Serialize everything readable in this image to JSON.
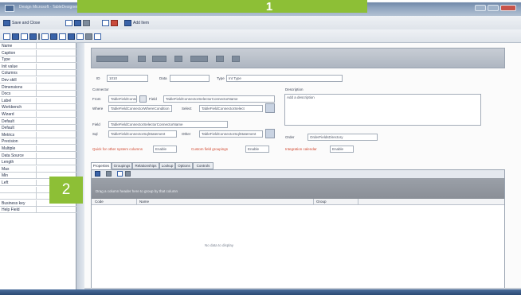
{
  "window": {
    "title": "Design Microsoft · TableDesigner · Microsoft Dynamics",
    "controls": [
      "minimize",
      "maximize",
      "close"
    ]
  },
  "callouts": [
    "1",
    "2"
  ],
  "toolbar1": {
    "items": [
      {
        "label": "Save and Close",
        "icon": "save-icon"
      },
      {
        "label": "",
        "icon": "new-icon"
      },
      {
        "label": "",
        "icon": "delete-icon"
      },
      {
        "label": "Add Item",
        "icon": "add-icon"
      }
    ]
  },
  "toolbar2": {
    "icons": [
      "text-icon",
      "field-icon",
      "grid-icon",
      "list-icon",
      "table-icon",
      "link-icon",
      "image-icon",
      "chart-icon",
      "help-icon"
    ]
  },
  "left_pane": {
    "rows": [
      {
        "label": "Name",
        "value": ""
      },
      {
        "label": "Caption",
        "value": ""
      },
      {
        "label": "Type",
        "value": ""
      },
      {
        "label": "Init value",
        "value": ""
      },
      {
        "label": "Columns",
        "value": ""
      },
      {
        "label": "Dev skill",
        "value": ""
      },
      {
        "label": "Dimensions",
        "value": ""
      },
      {
        "label": "Docs",
        "value": ""
      },
      {
        "label": "Label",
        "value": ""
      },
      {
        "label": "Workbench",
        "value": ""
      },
      {
        "label": "Wizard",
        "value": ""
      },
      {
        "label": "Default",
        "value": ""
      },
      {
        "label": "Default",
        "value": ""
      },
      {
        "label": "Metrics",
        "value": ""
      },
      {
        "label": "Precision",
        "value": ""
      },
      {
        "label": "Multiple",
        "value": ""
      },
      {
        "label": "Data Source",
        "value": ""
      },
      {
        "label": "Length",
        "value": ""
      },
      {
        "label": "Max",
        "value": ""
      },
      {
        "label": "Min",
        "value": ""
      },
      {
        "label": "Left",
        "value": ""
      },
      {
        "label": "",
        "value": ""
      },
      {
        "label": "",
        "value": ""
      },
      {
        "label": "Business key",
        "value": ""
      },
      {
        "label": "Help Field",
        "value": ""
      }
    ]
  },
  "form": {
    "id_label": "ID",
    "id_value": "1010",
    "data_label": "Data",
    "data_value": "",
    "type_label": "Type",
    "type_value": "Int Type",
    "connector_label": "Connector",
    "description_label": "Description",
    "description_value": "Add a description",
    "from_label": "From",
    "from_value": "TableFieldConnectorConnectorName",
    "where_label": "Where",
    "where_value": "TableFieldConnectorWhereCondition",
    "select_label": "Select",
    "select_value": "TableFieldConnectorSelect",
    "field_label": "Field",
    "field_value": "TableFieldConnectorSelectorConnectorName",
    "sql_label": "Sql",
    "sql_value": "TableFieldConnectorSqlStatement",
    "sql2_label": "Other",
    "sql2_value": "TableFieldConnectorSqlStatement",
    "order_label": "Order",
    "order_value": "OrderFieldsDirectory",
    "check_label_1": "Quick for other system columns",
    "check_value_1": "Enable",
    "check_label_2": "Custom field groupings",
    "check_value_2": "Enable",
    "check_label_3": "Integration calendar",
    "check_value_3": "Enable"
  },
  "tabs": [
    "Properties",
    "Groupings",
    "Relationships",
    "Lookup",
    "Options",
    "Controls"
  ],
  "grid": {
    "tip": "Drag a column header here to group by that column",
    "columns": [
      "Code",
      "Name",
      "Group"
    ],
    "empty_text": "No data to display"
  }
}
